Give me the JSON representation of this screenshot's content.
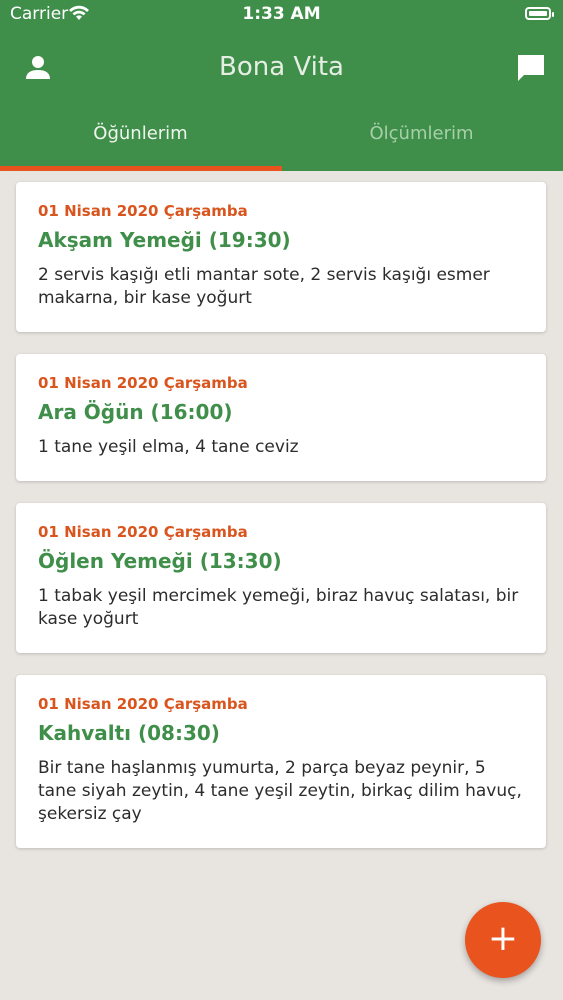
{
  "status_bar": {
    "carrier": "Carrier",
    "time": "1:33 AM"
  },
  "app": {
    "title": "Bona Vita"
  },
  "tabs": [
    {
      "label": "Öğünlerim",
      "active": true
    },
    {
      "label": "Ölçümlerim",
      "active": false
    }
  ],
  "meals": [
    {
      "date": "01 Nisan 2020 Çarşamba",
      "title": "Akşam Yemeği (19:30)",
      "description": "2 servis kaşığı etli mantar sote, 2 servis kaşığı esmer makarna, bir kase yoğurt"
    },
    {
      "date": "01 Nisan 2020 Çarşamba",
      "title": "Ara Öğün (16:00)",
      "description": "1 tane yeşil elma, 4 tane ceviz"
    },
    {
      "date": "01 Nisan 2020 Çarşamba",
      "title": "Öğlen Yemeği (13:30)",
      "description": "1 tabak yeşil mercimek yemeği, biraz havuç salatası, bir kase yoğurt"
    },
    {
      "date": "01 Nisan 2020 Çarşamba",
      "title": "Kahvaltı (08:30)",
      "description": "Bir tane haşlanmış yumurta, 2 parça beyaz peynir, 5 tane siyah zeytin, 4 tane yeşil zeytin, birkaç dilim havuç, şekersiz çay"
    }
  ],
  "fab": {
    "label": "+"
  },
  "icons": {
    "profile": "person-icon",
    "chat": "chat-bubble-icon",
    "wifi": "wifi-icon",
    "battery": "battery-icon"
  },
  "colors": {
    "header": "#3f8f4a",
    "accent": "#e8531e",
    "background": "#e8e4e0",
    "meal_title": "#3f8f4a",
    "meal_date": "#d9551d"
  }
}
